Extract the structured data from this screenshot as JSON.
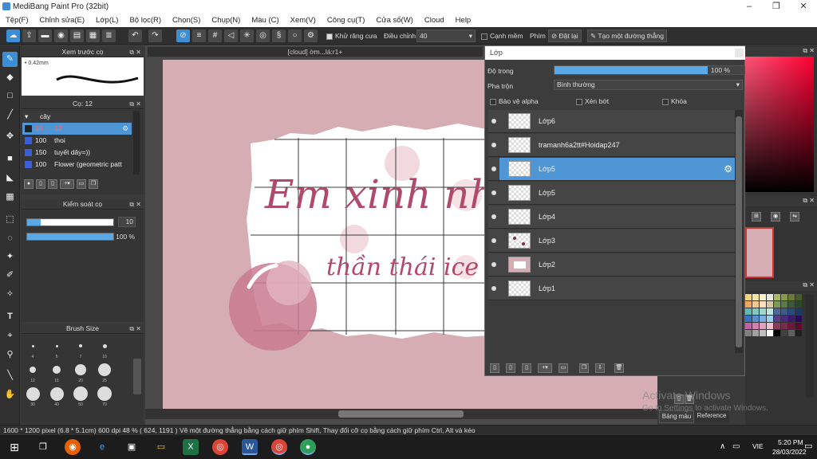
{
  "app": {
    "title": "MediBang Paint Pro (32bit)"
  },
  "menu": [
    "Tệp(F)",
    "Chỉnh sửa(E)",
    "Lớp(L)",
    "Bộ lọc(R)",
    "Chọn(S)",
    "Chụp(N)",
    "Màu (C)",
    "Xem(V)",
    "Công cụ(T)",
    "Cửa sổ(W)",
    "Cloud",
    "Help"
  ],
  "toolbar": {
    "antialias_label": "Khử răng cưa",
    "correction_label": "Điều chỉnh",
    "correction_value": "40",
    "smooth_edge_label": "Cạnh mềm",
    "key_label": "Phím",
    "reset_label": "Đặt lại",
    "straight_line_label": "Tạo một đường thẳng"
  },
  "brush_preview": {
    "title": "Xem trước cọ",
    "size": "0.42mm"
  },
  "brush_list": {
    "title": "Cọ: 12",
    "folder": "cây",
    "items": [
      {
        "size": "10",
        "name": "12"
      },
      {
        "size": "100",
        "name": "thoi"
      },
      {
        "size": "150",
        "name": "tuyết dây=))"
      },
      {
        "size": "100",
        "name": "Flower (geometric patt"
      }
    ]
  },
  "brush_control": {
    "title": "Kiểm soát cọ",
    "size": "10",
    "size_ratio": 0.16,
    "opacity": "100 %",
    "opacity_ratio": 1.0
  },
  "brush_size": {
    "title": "Brush Size",
    "labels": [
      "4",
      "5",
      "7",
      "10",
      "12",
      "15",
      "20",
      "25",
      "30",
      "40",
      "50",
      "70"
    ]
  },
  "document": {
    "tab": "[cloud] ờm...lá:r1+"
  },
  "canvas_text": {
    "line1": "Em xinh như ho",
    "line2": "thần thái ice"
  },
  "layer_window": {
    "title": "Lớp",
    "opacity_label": "Độ trong",
    "opacity_value": "100 %",
    "opacity_ratio": 1.0,
    "blend_label": "Pha trộn",
    "blend_value": "Bình thường",
    "protect_alpha": "Bảo vệ alpha",
    "clipping": "Xén bớt",
    "lock": "Khóa",
    "layers": [
      "Lớp6",
      "tramanh6a2tt#Hoidap247",
      "Lớp5",
      "Lớp5",
      "Lớp4",
      "Lớp3",
      "Lớp2",
      "Lớp1"
    ],
    "selected_index": 2
  },
  "right_panel": {
    "tab1": "Bảng màu",
    "tab2": "Reference"
  },
  "watermark": {
    "line1": "Activate Windows",
    "line2": "Go to Settings to activate Windows."
  },
  "status": {
    "text": "1600 * 1200 pixel   (6.8 * 5.1cm)   600 dpi   48 %   ( 624, 1191 )   Vẽ một đường thẳng bằng cách giữ phím Shift, Thay đổi cỡ cọ bằng cách giữ phím Ctrl, Alt và kéo"
  },
  "taskbar": {
    "lang": "VIE",
    "time": "5:20 PM",
    "date": "28/03/2022"
  },
  "colors": {
    "accent": "#3c8fd6",
    "canvas_bg": "#d6adb3",
    "text_color": "#b04a6a"
  }
}
